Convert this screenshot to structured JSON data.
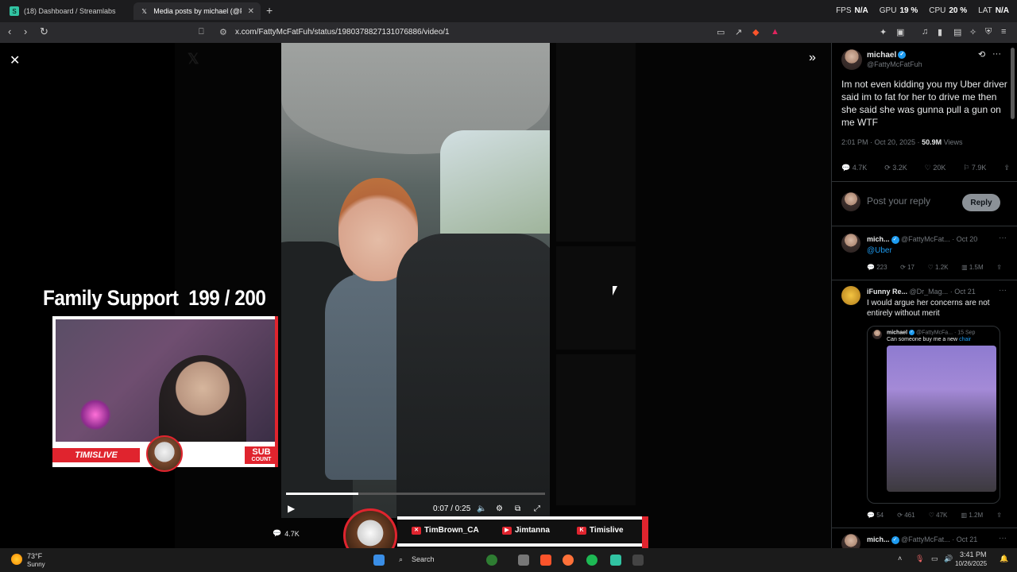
{
  "browser": {
    "tabs": [
      {
        "title": "(18) Dashboard / Streamlabs",
        "active": false
      },
      {
        "title": "Media posts by michael (@Fatty",
        "active": true
      }
    ],
    "url": "x.com/FattyMcFatFuh/status/1980378827131076886/video/1",
    "stats": [
      {
        "label": "FPS",
        "value": "N/A"
      },
      {
        "label": "GPU",
        "value": "19 %"
      },
      {
        "label": "CPU",
        "value": "20 %"
      },
      {
        "label": "LAT",
        "value": "N/A"
      }
    ]
  },
  "video": {
    "time": "0:07 / 0:25",
    "progress": 0.28,
    "reply_count": "4.7K"
  },
  "overlay": {
    "family_support": "Family Support  199 / 200",
    "brand": "TIMISLIVE",
    "sub_count_top": "SUB",
    "sub_count_bottom": "COUNT",
    "socials": [
      {
        "icon": "x-icon",
        "label": "TimBrown_CA"
      },
      {
        "icon": "youtube-icon",
        "label": "Jimtanna"
      },
      {
        "icon": "kick-icon",
        "label": "Timislive"
      }
    ]
  },
  "tweet": {
    "name": "michael",
    "handle": "@FattyMcFatFuh",
    "text": "Im not even kidding you my Uber driver said im to fat for her to drive me then she said she was gunna pull a gun on me WTF",
    "time": "2:01 PM · Oct 20, 2025 ·",
    "views": "50.9M",
    "views_label": "Views",
    "metrics": {
      "replies": "4.7K",
      "reposts": "3.2K",
      "likes": "20K",
      "bookmarks": "7.9K"
    },
    "reply_placeholder": "Post your reply",
    "reply_button": "Reply"
  },
  "replies": [
    {
      "name": "mich...",
      "handle": "@FattyMcFat...",
      "date": "· Oct 20",
      "text": "@Uber",
      "metrics": {
        "replies": "223",
        "reposts": "17",
        "likes": "1.2K",
        "views": "1.5M"
      }
    },
    {
      "name": "iFunny Re...",
      "handle": "@Dr_Mag...",
      "date": "· Oct 21",
      "text_line1": "I would argue her concerns are not",
      "text_line2": "entirely without merit",
      "quote": {
        "name": "michael",
        "handle": "@FattyMcFa...",
        "date": "· 15 Sep",
        "text": "Can someone buy me a new",
        "link": "chair"
      },
      "metrics": {
        "replies": "54",
        "reposts": "461",
        "likes": "47K",
        "views": "1.2M"
      }
    },
    {
      "name": "mich...",
      "handle": "@FattyMcFat...",
      "date": "· Oct 21"
    }
  ],
  "taskbar": {
    "weather_temp": "73°F",
    "weather_desc": "Sunny",
    "search": "Search",
    "time": "3:41 PM",
    "date": "10/26/2025"
  }
}
